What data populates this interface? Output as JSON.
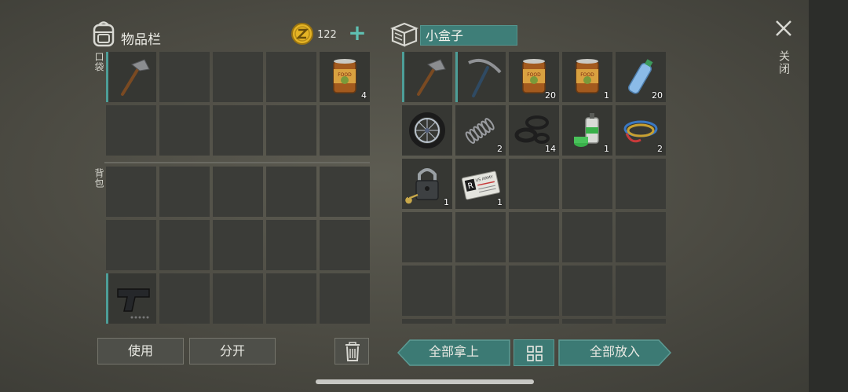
{
  "inventory": {
    "title": "物品栏",
    "coins": "122",
    "add_coins_label": "+",
    "pockets_label": "口袋",
    "backpack_label": "背包",
    "pockets": [
      {
        "item": "hatchet-icon",
        "qty": ""
      },
      {
        "item": "",
        "qty": ""
      },
      {
        "item": "",
        "qty": ""
      },
      {
        "item": "",
        "qty": ""
      },
      {
        "item": "canned-food-icon",
        "qty": "4"
      },
      {
        "item": "",
        "qty": ""
      },
      {
        "item": "",
        "qty": ""
      },
      {
        "item": "",
        "qty": ""
      },
      {
        "item": "",
        "qty": ""
      },
      {
        "item": "",
        "qty": ""
      }
    ],
    "backpack": [
      {
        "item": "",
        "qty": ""
      },
      {
        "item": "",
        "qty": ""
      },
      {
        "item": "",
        "qty": ""
      },
      {
        "item": "",
        "qty": ""
      },
      {
        "item": "",
        "qty": ""
      },
      {
        "item": "",
        "qty": ""
      },
      {
        "item": "",
        "qty": ""
      },
      {
        "item": "",
        "qty": ""
      },
      {
        "item": "",
        "qty": ""
      },
      {
        "item": "",
        "qty": ""
      },
      {
        "item": "pistol-icon",
        "qty": ""
      },
      {
        "item": "",
        "qty": ""
      },
      {
        "item": "",
        "qty": ""
      },
      {
        "item": "",
        "qty": ""
      },
      {
        "item": "",
        "qty": ""
      }
    ]
  },
  "container": {
    "name": "小盒子",
    "slots": [
      {
        "item": "hatchet-icon",
        "qty": ""
      },
      {
        "item": "pickaxe-icon",
        "qty": ""
      },
      {
        "item": "canned-food-icon",
        "qty": "20"
      },
      {
        "item": "canned-food-icon",
        "qty": "1"
      },
      {
        "item": "water-bottle-icon",
        "qty": "20"
      },
      {
        "item": "wheel-icon",
        "qty": ""
      },
      {
        "item": "spring-icon",
        "qty": "2"
      },
      {
        "item": "rubber-seals-icon",
        "qty": "14"
      },
      {
        "item": "spray-paint-icon",
        "qty": "1"
      },
      {
        "item": "wires-icon",
        "qty": "2"
      },
      {
        "item": "padlock-icon",
        "qty": "1"
      },
      {
        "item": "id-card-icon",
        "qty": "1"
      },
      {
        "item": "",
        "qty": ""
      },
      {
        "item": "",
        "qty": ""
      },
      {
        "item": "",
        "qty": ""
      },
      {
        "item": "",
        "qty": ""
      },
      {
        "item": "",
        "qty": ""
      },
      {
        "item": "",
        "qty": ""
      },
      {
        "item": "",
        "qty": ""
      },
      {
        "item": "",
        "qty": ""
      },
      {
        "item": "",
        "qty": ""
      },
      {
        "item": "",
        "qty": ""
      },
      {
        "item": "",
        "qty": ""
      },
      {
        "item": "",
        "qty": ""
      },
      {
        "item": "",
        "qty": ""
      },
      {
        "item": "",
        "qty": ""
      },
      {
        "item": "",
        "qty": ""
      },
      {
        "item": "",
        "qty": ""
      },
      {
        "item": "",
        "qty": ""
      },
      {
        "item": "",
        "qty": ""
      }
    ]
  },
  "item_labels": {
    "canned_food": "FOOD",
    "id_card_letter": "R",
    "id_card_text": "US ARMY"
  },
  "buttons": {
    "use": "使用",
    "split": "分开",
    "take_all": "全部拿上",
    "put_all": "全部放入"
  },
  "close_label": "关闭",
  "colors": {
    "accent_teal": "#3e7e78",
    "slot_bg": "#3b3c38",
    "coin_gold": "#e5b425"
  }
}
